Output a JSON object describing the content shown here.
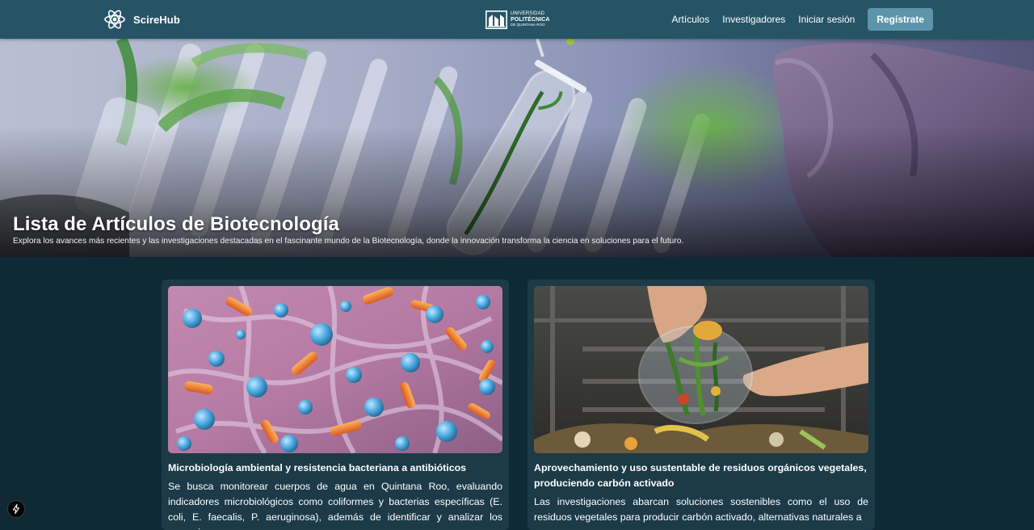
{
  "navbar": {
    "brand": "ScireHub",
    "university": {
      "line1": "UNIVERSIDAD",
      "line2": "POLITÉCNICA",
      "line3": "DE QUINTANA ROO"
    },
    "links": [
      "Artículos",
      "Investigadores",
      "Iniciar sesión"
    ],
    "register_label": "Regístrate"
  },
  "hero": {
    "title": "Lista de Artículos de Biotecnología",
    "subtitle": "Explora los avances más recientes y las investigaciones destacadas en el fascinante mundo de la Biotecnología, donde la innovación transforma la ciencia en soluciones para el futuro."
  },
  "articles": [
    {
      "title": "Microbiología ambiental y resistencia bacteriana a antibióticos",
      "excerpt": "Se busca monitorear cuerpos de agua en Quintana Roo, evaluando indicadores microbiológicos como coliformes y bacterias específicas (E. coli, E. faecalis, P. aeruginosa), además de identificar y analizar los mecanismos"
    },
    {
      "title": "Aprovechamiento y uso sustentable de residuos orgánicos vegetales, produciendo carbón activado",
      "excerpt": "Las investigaciones abarcan soluciones sostenibles como el uso de residuos vegetales para producir carbón activado, alternativas naturales a"
    }
  ],
  "icons": {
    "brand": "atom-icon",
    "fab": "lightning-icon"
  },
  "colors": {
    "navbar": "#265466",
    "page_bg": "#102a35",
    "card_bg": "#1c3a48",
    "button": "#5b94ab"
  }
}
